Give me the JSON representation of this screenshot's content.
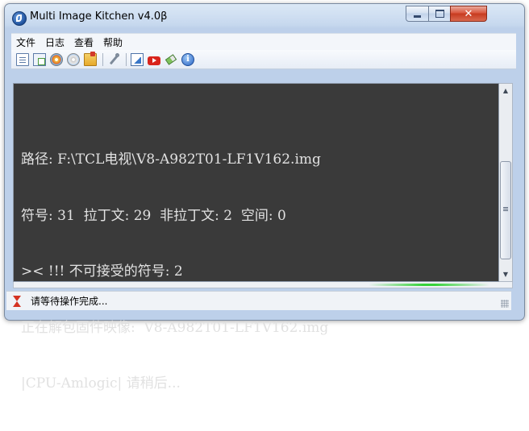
{
  "window": {
    "title": "Multi Image Kitchen v4.0β"
  },
  "menu": [
    {
      "label": "文件"
    },
    {
      "label": "日志"
    },
    {
      "label": "查看"
    },
    {
      "label": "帮助"
    }
  ],
  "toolbar": {
    "icons": [
      "new-document-icon",
      "copy-document-icon",
      "disc-icon",
      "cd-icon",
      "open-folder-icon",
      "wrench-icon",
      "chart-icon",
      "video-icon",
      "eraser-icon",
      "info-icon"
    ]
  },
  "console": {
    "lines": [
      "路径: F:\\TCL电视\\V8-A982T01-LF1V162.img",
      "符号: 31  拉丁文: 29  非拉丁文: 2  空间: 0",
      ">< !!! 不可接受的符号: 2",
      "正在解包固件映像:  V8-A982T01-LF1V162.img",
      "|CPU-Amlogic| 请稍后..."
    ],
    "background": "#3a3a3a",
    "text_color": "#e1e1e1"
  },
  "progress": {
    "accent": "#37d23b"
  },
  "status": {
    "text": "请等待操作完成..."
  }
}
